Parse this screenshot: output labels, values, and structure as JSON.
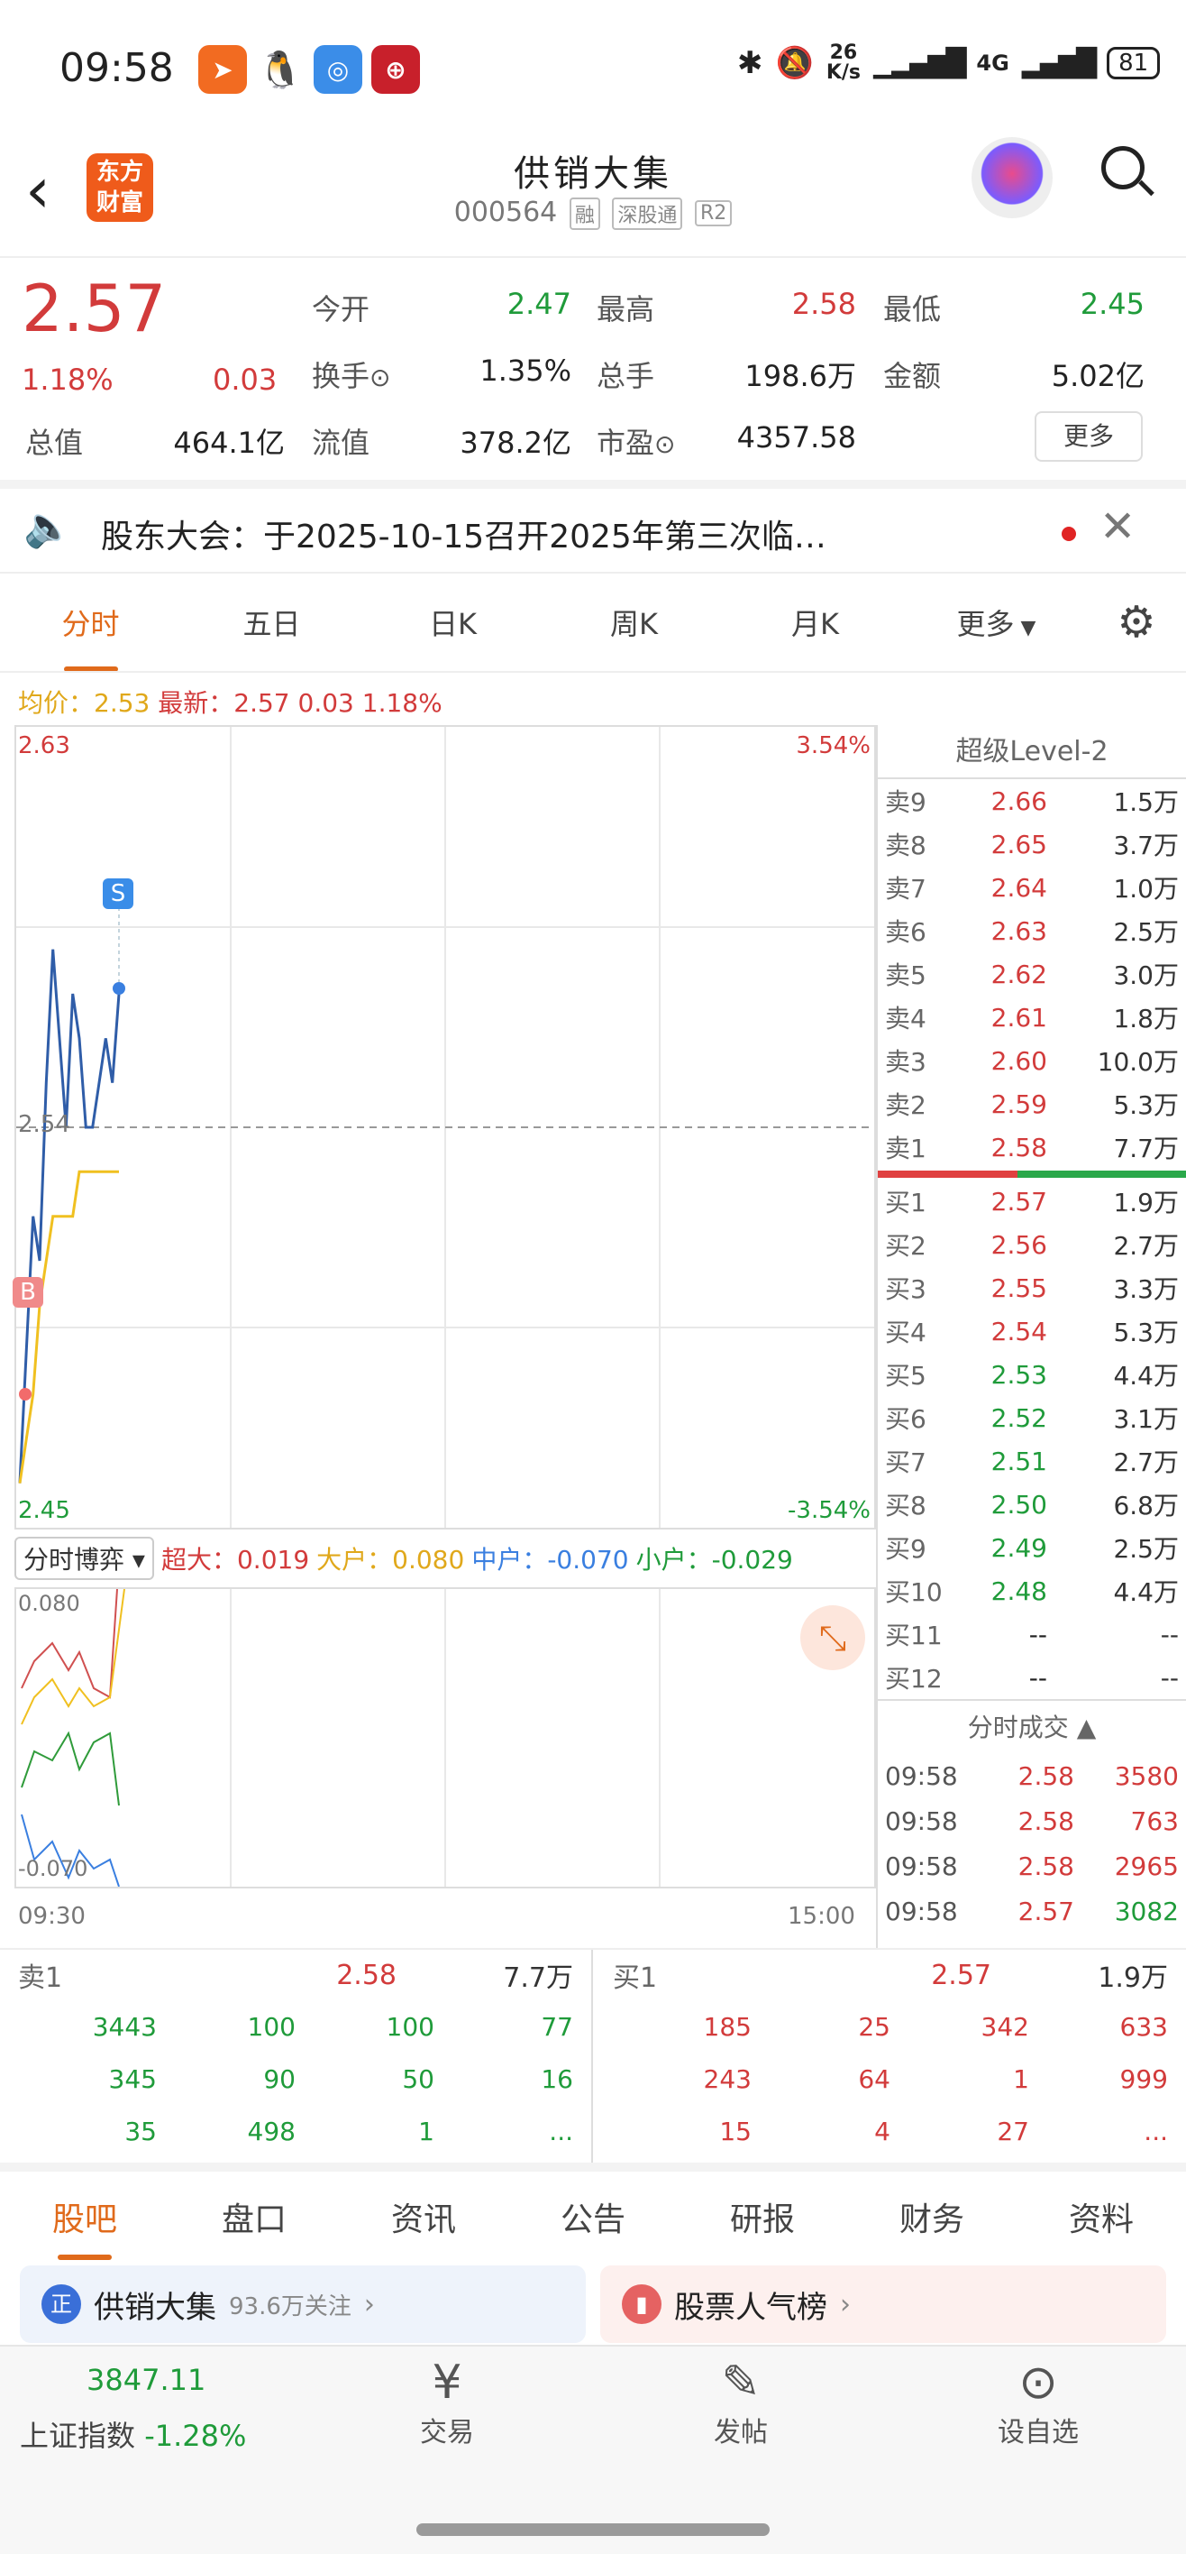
{
  "status_bar": {
    "time": "09:58",
    "net_speed": "26",
    "net_unit": "K/s",
    "network": "4G",
    "battery": "81"
  },
  "header": {
    "logo_line1": "东方",
    "logo_line2": "财富",
    "title": "供销大集",
    "code": "000564",
    "tags": [
      "融",
      "深股通",
      "R2"
    ]
  },
  "quote": {
    "price": "2.57",
    "change_pct": "1.18%",
    "change": "0.03",
    "open_label": "今开",
    "open": "2.47",
    "high_label": "最高",
    "high": "2.58",
    "low_label": "最低",
    "low": "2.45",
    "turnover_label": "换手",
    "turnover": "1.35%",
    "volume_label": "总手",
    "volume": "198.6万",
    "amount_label": "金额",
    "amount": "5.02亿",
    "mktcap_label": "总值",
    "mktcap": "464.1亿",
    "float_label": "流值",
    "float": "378.2亿",
    "pe_label": "市盈",
    "pe": "4357.58",
    "more_button": "更多"
  },
  "notice": {
    "text": "股东大会：于2025-10-15召开2025年第三次临…"
  },
  "chart_tabs": [
    "分时",
    "五日",
    "日K",
    "周K",
    "月K",
    "更多",
    ""
  ],
  "chart_info": {
    "avg": "均价：2.53",
    "latest": "最新：2.57 0.03 1.18%"
  },
  "intraday": {
    "y_top": "2.63",
    "y_bottom": "2.45",
    "y_mid": "2.54",
    "pct_top": "3.54%",
    "pct_bottom": "-3.54%",
    "marker_s": "S",
    "marker_b": "B",
    "time_start": "09:30",
    "time_end": "15:00"
  },
  "chart_data": {
    "type": "line",
    "ylim": [
      2.45,
      2.63
    ],
    "series": [
      {
        "values": [
          2.46,
          2.49,
          2.52,
          2.51,
          2.55,
          2.58,
          2.56,
          2.54,
          2.57,
          2.56,
          2.54,
          2.54,
          2.55,
          2.56,
          2.55,
          2.57
        ]
      },
      {
        "values": [
          2.46,
          2.47,
          2.48,
          2.5,
          2.51,
          2.52,
          2.52,
          2.52,
          2.52,
          2.53,
          2.53,
          2.53,
          2.53,
          2.53,
          2.53,
          2.53
        ]
      }
    ]
  },
  "flow": {
    "selector": "分时博弈",
    "super_large": "超大：0.019",
    "large": "大户：0.080",
    "medium": "中户：-0.070",
    "small": "小户：-0.029",
    "y_top": "0.080",
    "y_bottom": "-0.070"
  },
  "orderbook": {
    "title": "超级Level-2",
    "asks": [
      {
        "label": "卖9",
        "price": "2.66",
        "vol": "1.5万"
      },
      {
        "label": "卖8",
        "price": "2.65",
        "vol": "3.7万"
      },
      {
        "label": "卖7",
        "price": "2.64",
        "vol": "1.0万"
      },
      {
        "label": "卖6",
        "price": "2.63",
        "vol": "2.5万"
      },
      {
        "label": "卖5",
        "price": "2.62",
        "vol": "3.0万"
      },
      {
        "label": "卖4",
        "price": "2.61",
        "vol": "1.8万"
      },
      {
        "label": "卖3",
        "price": "2.60",
        "vol": "10.0万"
      },
      {
        "label": "卖2",
        "price": "2.59",
        "vol": "5.3万"
      },
      {
        "label": "卖1",
        "price": "2.58",
        "vol": "7.7万"
      }
    ],
    "bids": [
      {
        "label": "买1",
        "price": "2.57",
        "vol": "1.9万"
      },
      {
        "label": "买2",
        "price": "2.56",
        "vol": "2.7万"
      },
      {
        "label": "买3",
        "price": "2.55",
        "vol": "3.3万"
      },
      {
        "label": "买4",
        "price": "2.54",
        "vol": "5.3万"
      },
      {
        "label": "买5",
        "price": "2.53",
        "vol": "4.4万"
      },
      {
        "label": "买6",
        "price": "2.52",
        "vol": "3.1万"
      },
      {
        "label": "买7",
        "price": "2.51",
        "vol": "2.7万"
      },
      {
        "label": "买8",
        "price": "2.50",
        "vol": "6.8万"
      },
      {
        "label": "买9",
        "price": "2.49",
        "vol": "2.5万"
      },
      {
        "label": "买10",
        "price": "2.48",
        "vol": "4.4万"
      },
      {
        "label": "买11",
        "price": "--",
        "vol": "--"
      },
      {
        "label": "买12",
        "price": "--",
        "vol": "--"
      }
    ],
    "trades_title": "分时成交",
    "trades": [
      {
        "time": "09:58",
        "price": "2.58",
        "vol": "3580"
      },
      {
        "time": "09:58",
        "price": "2.58",
        "vol": "763"
      },
      {
        "time": "09:58",
        "price": "2.58",
        "vol": "2965"
      },
      {
        "time": "09:58",
        "price": "2.57",
        "vol": "3082"
      }
    ]
  },
  "queue": {
    "sell_label": "卖1",
    "sell_price": "2.58",
    "sell_vol": "7.7万",
    "buy_label": "买1",
    "buy_price": "2.57",
    "buy_vol": "1.9万",
    "sell_rows": [
      [
        "3443",
        "100",
        "100",
        "77"
      ],
      [
        "345",
        "90",
        "50",
        "16"
      ],
      [
        "35",
        "498",
        "1",
        "..."
      ]
    ],
    "buy_rows": [
      [
        "185",
        "25",
        "342",
        "633"
      ],
      [
        "243",
        "64",
        "1",
        "999"
      ],
      [
        "15",
        "4",
        "27",
        "..."
      ]
    ]
  },
  "bottom_tabs": [
    "股吧",
    "盘口",
    "资讯",
    "公告",
    "研报",
    "财务",
    "资料"
  ],
  "cards": {
    "left_title": "供销大集",
    "left_sub": "93.6万关注",
    "right_title": "股票人气榜"
  },
  "footer": {
    "index_value": "3847.11",
    "index_name": "上证指数",
    "index_change": "-1.28%",
    "trade": "交易",
    "post": "发帖",
    "watch": "设自选"
  },
  "colors": {
    "up": "#d23b3b",
    "down": "#1f9b3a",
    "accent": "#e06a1b"
  }
}
